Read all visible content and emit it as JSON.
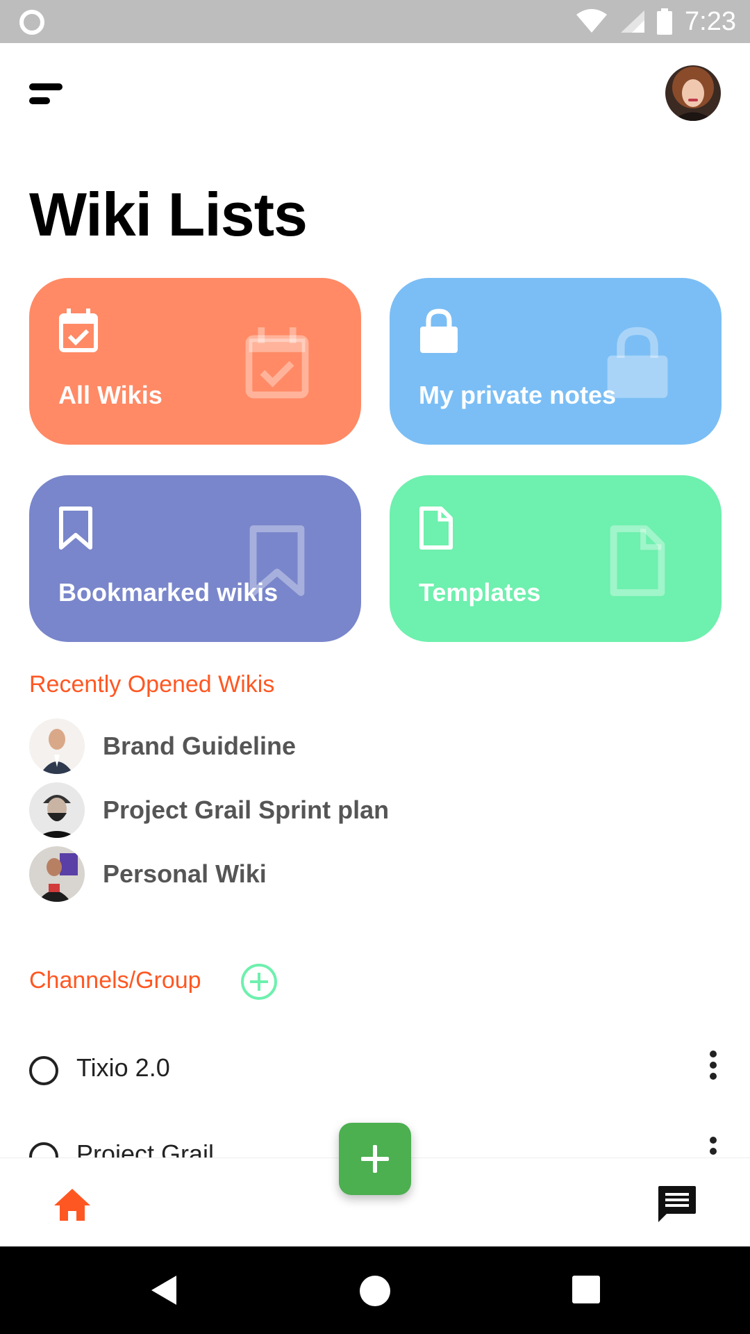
{
  "status_bar": {
    "time": "7:23"
  },
  "header": {
    "title": "Wiki Lists"
  },
  "cards": [
    {
      "label": "All Wikis",
      "icon": "calendar-check-icon",
      "color": "#ff8a65"
    },
    {
      "label": "My private notes",
      "icon": "lock-icon",
      "color": "#7bbef5"
    },
    {
      "label": "Bookmarked wikis",
      "icon": "bookmark-icon",
      "color": "#7986cb"
    },
    {
      "label": "Templates",
      "icon": "file-icon",
      "color": "#6ef0ae"
    }
  ],
  "recent": {
    "title": "Recently Opened Wikis",
    "items": [
      {
        "label": "Brand Guideline"
      },
      {
        "label": "Project Grail Sprint plan"
      },
      {
        "label": "Personal Wiki"
      }
    ]
  },
  "channels": {
    "title": "Channels/Group",
    "items": [
      {
        "label": "Tixio 2.0"
      },
      {
        "label": "Project Grail"
      }
    ]
  },
  "colors": {
    "accent": "#ff5722",
    "fab": "#4caf50",
    "add_icon": "#6ef0ae"
  }
}
